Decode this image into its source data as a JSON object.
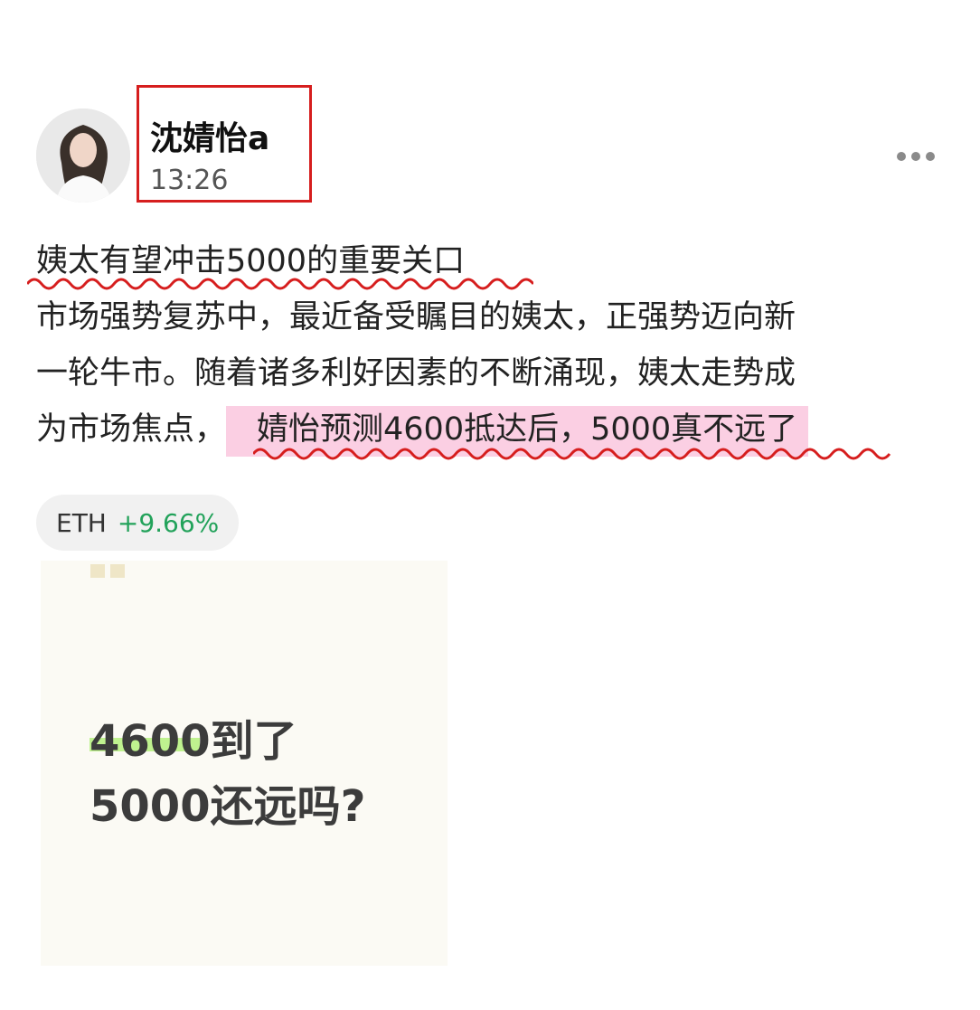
{
  "post": {
    "author": {
      "name": "沈婧怡a",
      "time": "13:26"
    },
    "more_icon": "more-horizontal-icon",
    "headline": "姨太有望冲击5000的重要关口",
    "paragraph_lines": [
      "市场强势复苏中，最近备受瞩目的姨太，正强势迈向新",
      "一轮牛市。随着诸多利好因素的不断涌现，姨太走势成",
      "为市场焦点，"
    ],
    "highlighted_text": "婧怡预测4600抵达后，5000真不远了",
    "tag": {
      "symbol": "ETH",
      "change": "+9.66%"
    },
    "image_card": {
      "line1": "4600到了",
      "line2": "5000还远吗?"
    }
  },
  "colors": {
    "name_box": "#d61e1e",
    "wavy_underline": "#d61e1e",
    "highlight": "#fbcfe3",
    "gain": "#22a25a",
    "card_background": "#fbfaf4",
    "card_highlight": "#bff28f"
  }
}
